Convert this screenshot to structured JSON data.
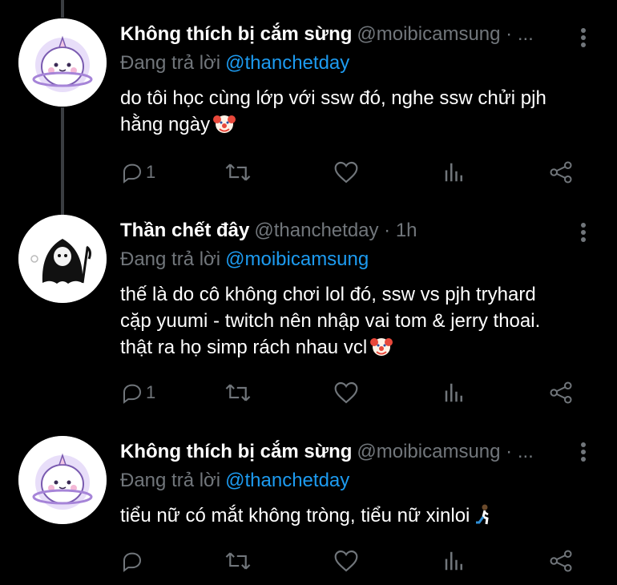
{
  "tweets": [
    {
      "name": "Không thích bị cắm sừng",
      "handle": "@moibicamsung · ...",
      "reply_prefix": "Đang trả lời",
      "reply_to": "@thanchetday",
      "body_lines": [
        "do tôi học cùng lớp với ssw đó, nghe ssw chửi pjh",
        "hằng ngày"
      ],
      "body_emoji": "clown-face",
      "reply_count": "1",
      "avatar": "ghost-unicorn-avatar"
    },
    {
      "name": "Thần chết đây",
      "handle": "@thanchetday · 1h",
      "reply_prefix": "Đang trả lời",
      "reply_to": "@moibicamsung",
      "body_lines": [
        "thế là do cô không chơi lol đó, ssw vs pjh tryhard",
        "cặp yuumi - twitch nên nhập vai tom & jerry thoai.",
        "thật ra họ simp rách nhau vcl"
      ],
      "body_emoji": "clown-face",
      "reply_count": "1",
      "avatar": "grim-reaper-avatar"
    },
    {
      "name": "Không thích bị cắm sừng",
      "handle": "@moibicamsung · ...",
      "reply_prefix": "Đang trả lời",
      "reply_to": "@thanchetday",
      "body_lines": [
        "tiểu nữ có mắt không tròng, tiểu nữ xinloi"
      ],
      "body_emoji": "person-kneeling",
      "reply_count": "",
      "avatar": "ghost-unicorn-avatar"
    }
  ],
  "colors": {
    "background": "#000000",
    "text": "#ffffff",
    "muted": "#71767b",
    "link": "#1d9bf0",
    "thread_line": "#3a3d41"
  },
  "icons": [
    "reply-icon",
    "retweet-icon",
    "like-icon",
    "analytics-icon",
    "share-icon",
    "more-icon"
  ]
}
